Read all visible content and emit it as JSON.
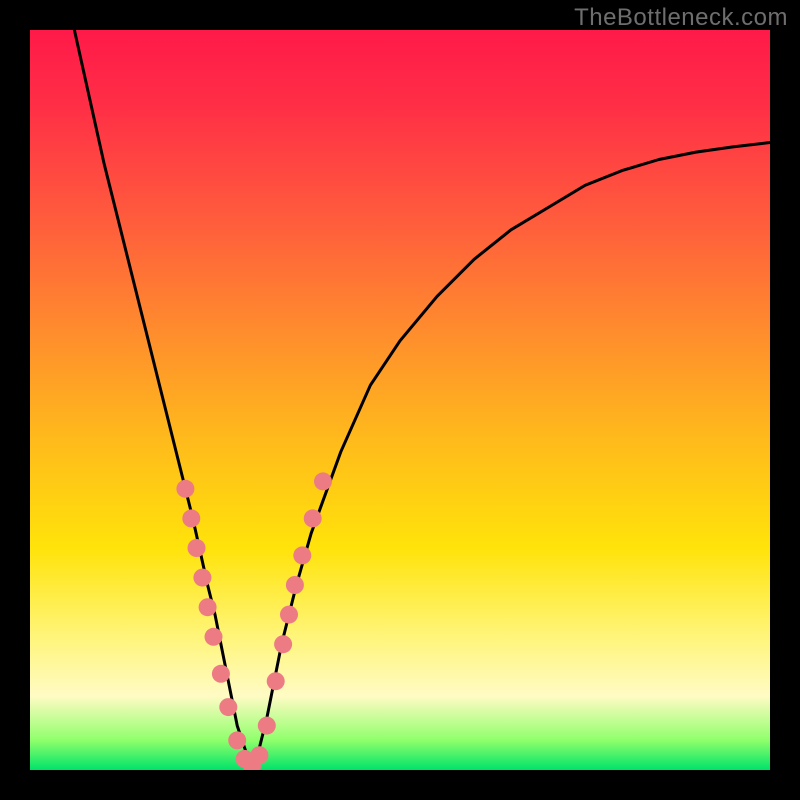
{
  "watermark": "TheBottleneck.com",
  "chart_data": {
    "type": "line",
    "title": "",
    "xlabel": "",
    "ylabel": "",
    "xlim": [
      0,
      100
    ],
    "ylim": [
      0,
      100
    ],
    "note": "Axes unlabeled in source; values are pixel-fraction estimates (0–100) read off the image.",
    "series": [
      {
        "name": "curve",
        "x": [
          6,
          8,
          10,
          12,
          14,
          16,
          18,
          20,
          22,
          24,
          25,
          26,
          27,
          28,
          29,
          30,
          31,
          32,
          33,
          34,
          36,
          38,
          42,
          46,
          50,
          55,
          60,
          65,
          70,
          75,
          80,
          85,
          90,
          95,
          100
        ],
        "y": [
          100,
          91,
          82,
          74,
          66,
          58,
          50,
          42,
          34,
          25,
          21,
          16,
          11,
          6,
          3,
          0,
          3,
          7,
          12,
          17,
          25,
          32,
          43,
          52,
          58,
          64,
          69,
          73,
          76,
          79,
          81,
          82.5,
          83.5,
          84.2,
          84.8
        ]
      }
    ],
    "markers": {
      "name": "highlighted-points",
      "color": "#ed7b84",
      "x": [
        21.0,
        21.8,
        22.5,
        23.3,
        24.0,
        24.8,
        25.8,
        26.8,
        28.0,
        29.0,
        30.0,
        31.0,
        32.0,
        33.2,
        34.2,
        35.0,
        35.8,
        36.8,
        38.2,
        39.6
      ],
      "y": [
        38.0,
        34.0,
        30.0,
        26.0,
        22.0,
        18.0,
        13.0,
        8.5,
        4.0,
        1.5,
        0.5,
        2.0,
        6.0,
        12.0,
        17.0,
        21.0,
        25.0,
        29.0,
        34.0,
        39.0
      ]
    },
    "background_gradient": {
      "direction": "top-to-bottom",
      "stops": [
        {
          "pos": 0.0,
          "color": "#ff1a49"
        },
        {
          "pos": 0.25,
          "color": "#ff5a3d"
        },
        {
          "pos": 0.55,
          "color": "#ffb91c"
        },
        {
          "pos": 0.82,
          "color": "#fff57a"
        },
        {
          "pos": 0.96,
          "color": "#8fff6b"
        },
        {
          "pos": 1.0,
          "color": "#00e36a"
        }
      ]
    }
  }
}
